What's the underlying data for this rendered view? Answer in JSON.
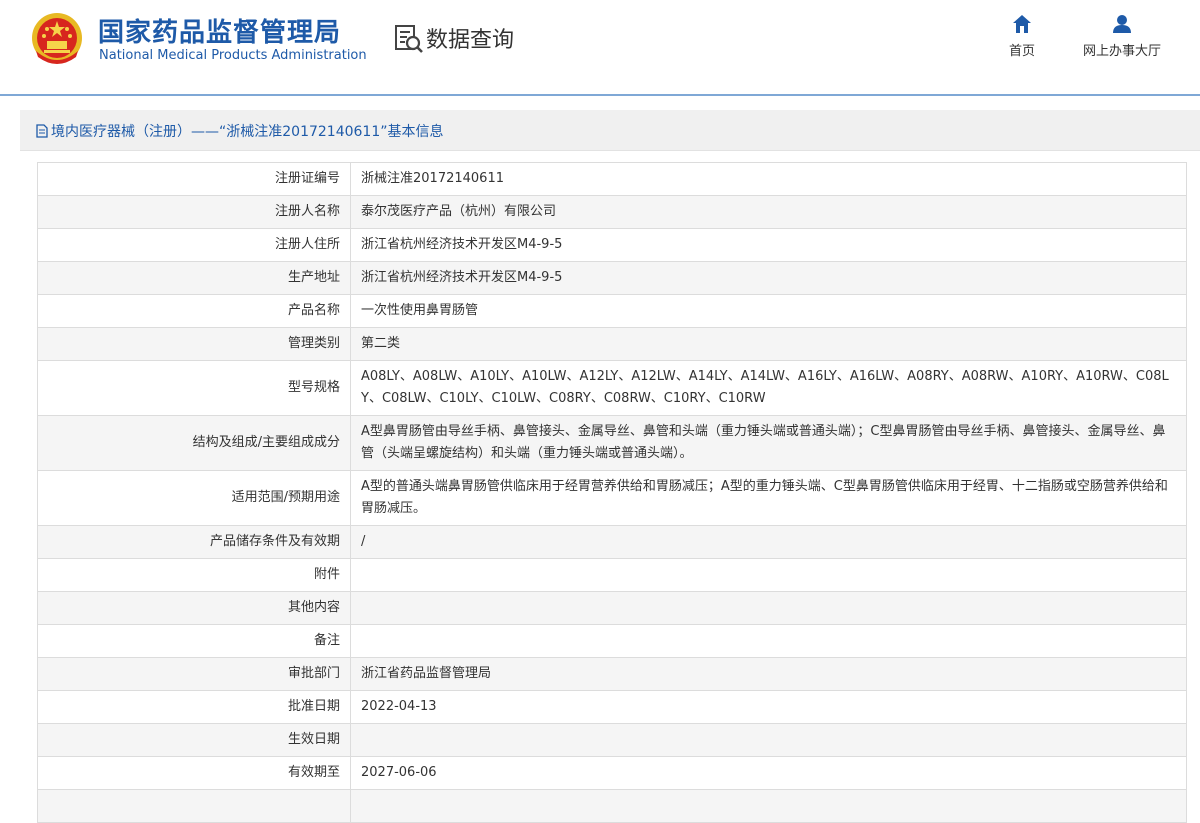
{
  "header": {
    "agency_cn": "国家药品监督管理局",
    "agency_en": "National Medical Products Administration",
    "query_title": "数据查询",
    "nav": [
      {
        "label": "首页",
        "icon": "home-icon"
      },
      {
        "label": "网上办事大厅",
        "icon": "user-icon"
      }
    ]
  },
  "breadcrumb": "境内医疗器械（注册）——“浙械注准20172140611”基本信息",
  "rows": [
    {
      "key": "注册证编号",
      "value": "浙械注准20172140611"
    },
    {
      "key": "注册人名称",
      "value": "泰尔茂医疗产品（杭州）有限公司"
    },
    {
      "key": "注册人住所",
      "value": "浙江省杭州经济技术开发区M4-9-5"
    },
    {
      "key": "生产地址",
      "value": "浙江省杭州经济技术开发区M4-9-5"
    },
    {
      "key": "产品名称",
      "value": "一次性使用鼻胃肠管"
    },
    {
      "key": "管理类别",
      "value": "第二类"
    },
    {
      "key": "型号规格",
      "value": "A08LY、A08LW、A10LY、A10LW、A12LY、A12LW、A14LY、A14LW、A16LY、A16LW、A08RY、A08RW、A10RY、A10RW、C08LY、C08LW、C10LY、C10LW、C08RY、C08RW、C10RY、C10RW"
    },
    {
      "key": "结构及组成/主要组成成分",
      "value": "A型鼻胃肠管由导丝手柄、鼻管接头、金属导丝、鼻管和头端（重力锤头端或普通头端）；C型鼻胃肠管由导丝手柄、鼻管接头、金属导丝、鼻管（头端呈螺旋结构）和头端（重力锤头端或普通头端）。"
    },
    {
      "key": "适用范围/预期用途",
      "value": "A型的普通头端鼻胃肠管供临床用于经胃营养供给和胃肠减压；A型的重力锤头端、C型鼻胃肠管供临床用于经胃、十二指肠或空肠营养供给和胃肠减压。"
    },
    {
      "key": "产品储存条件及有效期",
      "value": "/"
    },
    {
      "key": "附件",
      "value": ""
    },
    {
      "key": "其他内容",
      "value": ""
    },
    {
      "key": "备注",
      "value": ""
    },
    {
      "key": "审批部门",
      "value": "浙江省药品监督管理局"
    },
    {
      "key": "批准日期",
      "value": "2022-04-13"
    },
    {
      "key": "生效日期",
      "value": ""
    },
    {
      "key": "有效期至",
      "value": "2027-06-06"
    },
    {
      "key": "",
      "value": ""
    }
  ]
}
